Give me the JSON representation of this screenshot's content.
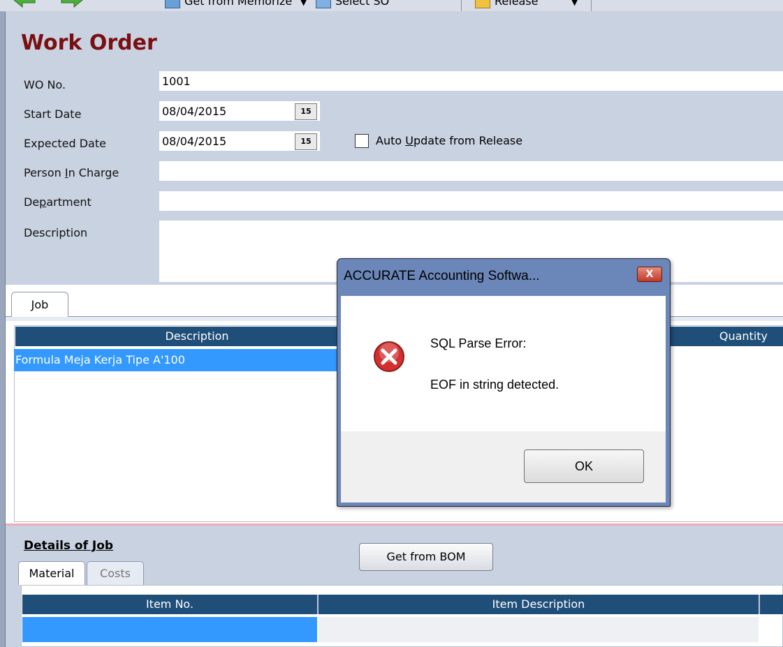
{
  "toolbar": {
    "get_memorize": "Get from Memorize",
    "select_so": "Select SO",
    "release": "Release"
  },
  "form": {
    "title": "Work Order",
    "wo_no_label": "WO No.",
    "wo_no_value": "1001",
    "start_date_label": "Start Date",
    "start_date_value": "08/04/2015",
    "expected_date_label": "Expected Date",
    "expected_date_value": "08/04/2015",
    "calendar_glyph": "15",
    "auto_update_label_pre": "Auto ",
    "auto_update_label_acc": "U",
    "auto_update_label_post": "pdate from Release",
    "pic_label_pre": "Person ",
    "pic_label_acc": "I",
    "pic_label_post": "n Charge",
    "dept_label_pre": "De",
    "dept_label_acc": "p",
    "dept_label_post": "artment",
    "description_label": "Description"
  },
  "job": {
    "tab_label": "Job",
    "columns": [
      "Description",
      "Quantity"
    ],
    "rows": [
      {
        "description": "Formula Meja Kerja Tipe A'100"
      }
    ]
  },
  "details": {
    "title": "Details of Job",
    "tabs": [
      "Material",
      "Costs"
    ],
    "get_bom": "Get from BOM",
    "columns": [
      "Item No.",
      "Item Description"
    ]
  },
  "dialog": {
    "title": "ACCURATE Accounting Softwa...",
    "close": "X",
    "line1": "SQL Parse Error:",
    "line2": "EOF in string detected.",
    "ok": "OK"
  },
  "colors": {
    "title_red": "#7a0f12",
    "grid_header": "#1f4e79",
    "selection": "#3399ff",
    "form_bg": "#c9d2e1"
  }
}
